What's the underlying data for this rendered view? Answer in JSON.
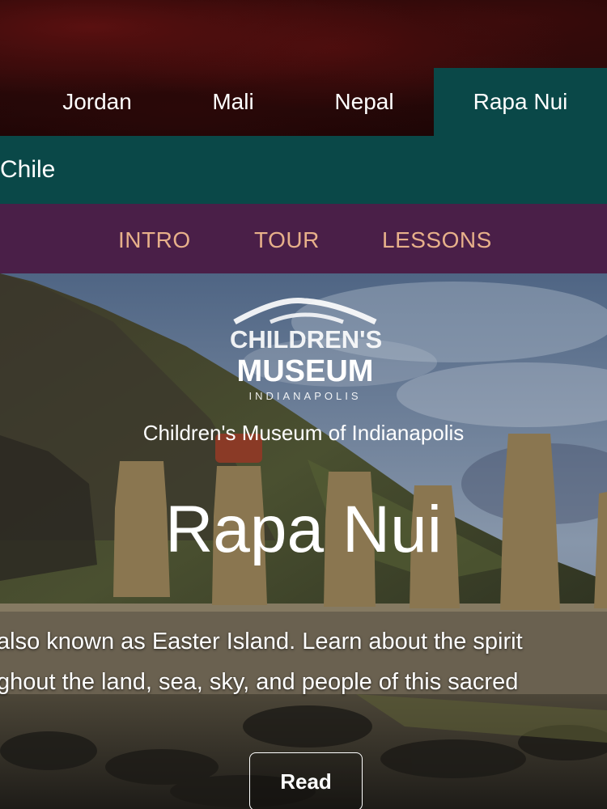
{
  "country_tabs": [
    {
      "label": "Jordan"
    },
    {
      "label": "Mali"
    },
    {
      "label": "Nepal"
    },
    {
      "label": "Rapa Nui",
      "active": true
    }
  ],
  "country_bar": {
    "label": "Chile"
  },
  "section_nav": [
    {
      "label": "INTRO"
    },
    {
      "label": "TOUR"
    },
    {
      "label": "LESSONS"
    }
  ],
  "hero": {
    "logo": {
      "line1": "CHILDREN'S",
      "line2": "MUSEUM",
      "line3": "INDIANAPOLIS"
    },
    "organization": "Children's Museum of Indianapolis",
    "title": "Rapa Nui",
    "description_line1": "also known as Easter Island. Learn about the spirit",
    "description_line2": "ghout the land, sea, sky, and people of this sacred",
    "read_button": "Read"
  },
  "colors": {
    "active_tab": "#0a4848",
    "section_nav_bg": "#4a1f48",
    "section_nav_text": "#e7b08a"
  }
}
